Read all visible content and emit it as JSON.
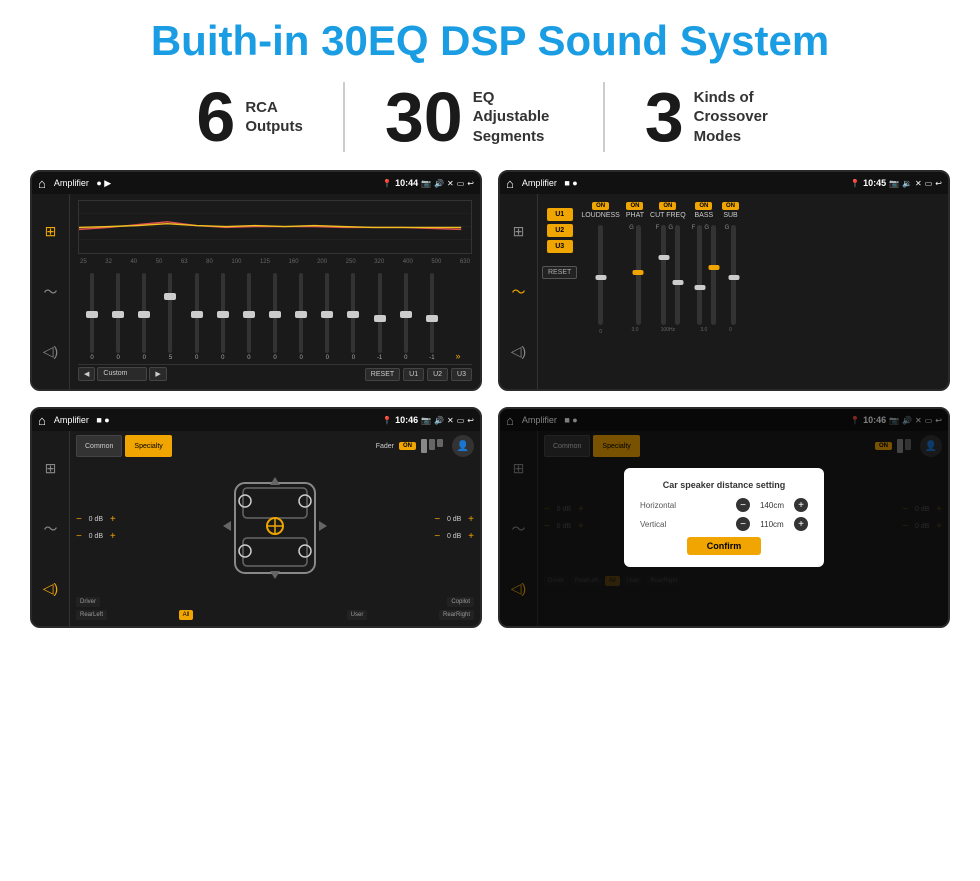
{
  "page": {
    "title": "Buith-in 30EQ DSP Sound System",
    "accent_color": "#1a9de2",
    "bg_color": "#ffffff"
  },
  "stats": [
    {
      "number": "6",
      "label": "RCA\nOutputs"
    },
    {
      "number": "30",
      "label": "EQ Adjustable\nSegments"
    },
    {
      "number": "3",
      "label": "Kinds of\nCrossover Modes"
    }
  ],
  "screens": [
    {
      "id": "eq-screen",
      "status_bar": {
        "app": "Amplifier",
        "time": "10:44"
      },
      "eq_labels": [
        "25",
        "32",
        "40",
        "50",
        "63",
        "80",
        "100",
        "125",
        "160",
        "200",
        "250",
        "320",
        "400",
        "500",
        "630"
      ],
      "eq_values": [
        "0",
        "0",
        "0",
        "5",
        "0",
        "0",
        "0",
        "0",
        "0",
        "0",
        "0",
        "-1",
        "0",
        "-1"
      ],
      "preset_label": "Custom",
      "buttons": [
        "RESET",
        "U1",
        "U2",
        "U3"
      ]
    },
    {
      "id": "crossover-screen",
      "status_bar": {
        "app": "Amplifier",
        "time": "10:45"
      },
      "presets": [
        "U1",
        "U2",
        "U3"
      ],
      "controls": [
        {
          "label": "LOUDNESS",
          "on": true
        },
        {
          "label": "PHAT",
          "on": true
        },
        {
          "label": "CUT FREQ",
          "on": true
        },
        {
          "label": "BASS",
          "on": true
        },
        {
          "label": "SUB",
          "on": true
        }
      ],
      "reset_label": "RESET"
    },
    {
      "id": "speaker-screen",
      "status_bar": {
        "app": "Amplifier",
        "time": "10:46"
      },
      "tabs": [
        "Common",
        "Specialty"
      ],
      "fader_label": "Fader",
      "fader_on": "ON",
      "vol_rows": [
        {
          "label": "",
          "value": "0 dB"
        },
        {
          "label": "",
          "value": "0 dB"
        },
        {
          "label": "",
          "value": "0 dB"
        },
        {
          "label": "",
          "value": "0 dB"
        }
      ],
      "bottom_labels": [
        "Driver",
        "",
        "Copilot",
        "RearLeft",
        "All",
        "",
        "User",
        "RearRight"
      ]
    },
    {
      "id": "dialog-screen",
      "status_bar": {
        "app": "Amplifier",
        "time": "10:46"
      },
      "tabs": [
        "Common",
        "Specialty"
      ],
      "dialog": {
        "title": "Car speaker distance setting",
        "horizontal_label": "Horizontal",
        "horizontal_value": "140cm",
        "vertical_label": "Vertical",
        "vertical_value": "110cm",
        "confirm_label": "Confirm"
      },
      "bottom_labels": [
        "Driver",
        "",
        "Copilot",
        "RearLeft",
        "All",
        "",
        "User",
        "RearRight"
      ]
    }
  ]
}
